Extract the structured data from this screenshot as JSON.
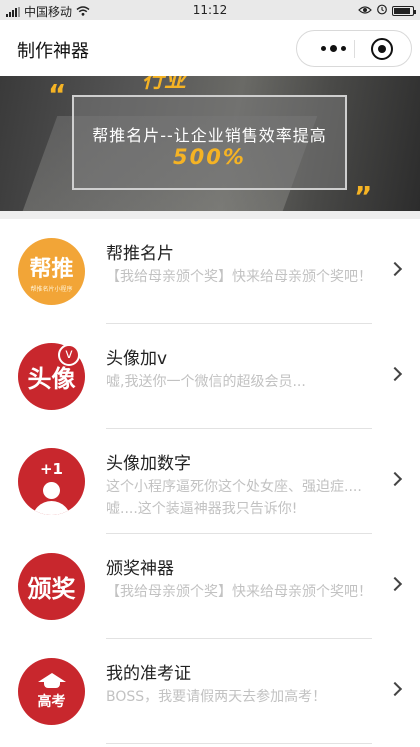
{
  "status_bar": {
    "carrier": "中国移动",
    "time": "11:12",
    "icons": [
      "signal-icon",
      "wifi-icon",
      "eye-icon",
      "alarm-icon",
      "battery-icon"
    ]
  },
  "nav": {
    "title": "制作神器",
    "more_icon": "more-dots-icon",
    "close_icon": "target-close-icon"
  },
  "banner": {
    "top_word": "行业",
    "headline": "帮推名片--让企业销售效率提高",
    "percent": "500%",
    "quote_open": "“",
    "quote_close": "”",
    "accent_color": "#f5b324"
  },
  "list": [
    {
      "title": "帮推名片",
      "desc": "【我给母亲颁个奖】快来给母亲颁个奖吧！",
      "avatar_text": "帮推",
      "avatar_sub": "帮推名片小程序",
      "avatar_color": "#f2a537"
    },
    {
      "title": "头像加v",
      "desc": "嘘,我送你一个微信的超级会员...",
      "avatar_text": "头像",
      "avatar_badge": "v",
      "avatar_color": "#c8272d"
    },
    {
      "title": "头像加数字",
      "desc": "这个小程序逼死你这个处女座、强迫症....嘘....这个装逼神器我只告诉你!",
      "avatar_text": "+1",
      "avatar_color": "#c8272d"
    },
    {
      "title": "颁奖神器",
      "desc": "【我给母亲颁个奖】快来给母亲颁个奖吧！",
      "avatar_text": "颁奖",
      "avatar_color": "#c8272d"
    },
    {
      "title": "我的准考证",
      "desc": "BOSS，我要请假两天去参加高考！",
      "avatar_text": "高考",
      "avatar_color": "#c8272d"
    }
  ]
}
